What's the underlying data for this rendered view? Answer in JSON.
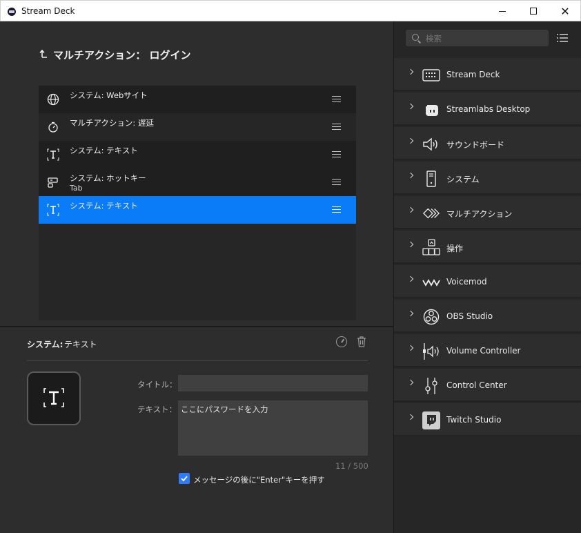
{
  "window": {
    "title": "Stream Deck",
    "close_glyph": "✕"
  },
  "editor": {
    "breadcrumb": "マルチアクション： ログイン",
    "actions": [
      {
        "label": "システム: Webサイト",
        "icon": "globe-icon"
      },
      {
        "label": "マルチアクション: 遅延",
        "icon": "stopwatch-icon"
      },
      {
        "label": "システム: テキスト",
        "icon": "text-icon"
      },
      {
        "label": "システム: ホットキー",
        "sublabel": "Tab",
        "icon": "hotkey-icon"
      },
      {
        "label": "システム: テキスト",
        "icon": "text-icon",
        "selected": true
      }
    ]
  },
  "inspector": {
    "title": "システム:",
    "subtitle": "テキスト",
    "title_label": "タイトル：",
    "title_value": "",
    "text_label": "テキスト：",
    "text_value": "ここにパスワードを入力",
    "char_count": "11 / 500",
    "enter_checkbox_label": "メッセージの後に\"Enter\"キーを押す",
    "enter_checked": true
  },
  "sidebar": {
    "search_placeholder": "検索",
    "categories": [
      {
        "label": "Stream Deck",
        "icon": "stream-deck-icon"
      },
      {
        "label": "Streamlabs Desktop",
        "icon": "streamlabs-icon"
      },
      {
        "label": "サウンドボード",
        "icon": "speaker-icon"
      },
      {
        "label": "システム",
        "icon": "pc-tower-icon"
      },
      {
        "label": "マルチアクション",
        "icon": "multi-action-icon"
      },
      {
        "label": "操作",
        "icon": "arrow-keys-icon"
      },
      {
        "label": "Voicemod",
        "icon": "voicemod-icon"
      },
      {
        "label": "OBS Studio",
        "icon": "obs-icon"
      },
      {
        "label": "Volume Controller",
        "icon": "volume-controller-icon"
      },
      {
        "label": "Control Center",
        "icon": "sliders-icon"
      },
      {
        "label": "Twitch Studio",
        "icon": "twitch-icon"
      }
    ]
  }
}
